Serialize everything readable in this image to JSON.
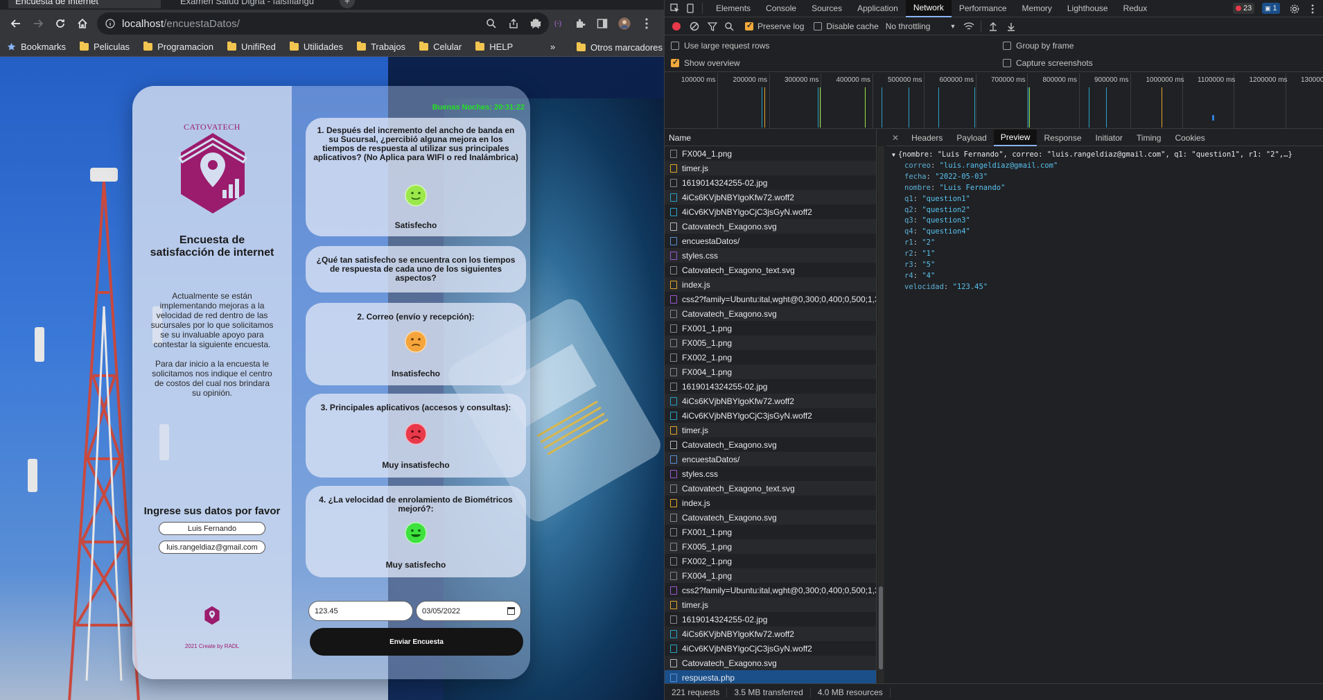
{
  "browser": {
    "tabs": [
      {
        "label": "Encuesta de Internet",
        "active": true
      },
      {
        "label": "Examen Salud Digna - falsIfiangu",
        "active": false
      }
    ],
    "url_host": "localhost",
    "url_path": "/encuestaDatos/",
    "bookmarks": [
      {
        "label": "Bookmarks",
        "icon": "star-icon"
      },
      {
        "label": "Peliculas",
        "icon": "folder-icon"
      },
      {
        "label": "Programacion",
        "icon": "folder-icon"
      },
      {
        "label": "UnifiRed",
        "icon": "folder-icon"
      },
      {
        "label": "Utilidades",
        "icon": "folder-icon"
      },
      {
        "label": "Trabajos",
        "icon": "folder-icon"
      },
      {
        "label": "Celular",
        "icon": "folder-icon"
      },
      {
        "label": "HELP",
        "icon": "folder-icon"
      }
    ],
    "bookmarks_more": "»",
    "other_bookmarks": "Otros marcadores"
  },
  "page": {
    "brand": "CATOVATECH",
    "title": "Encuesta de satisfacción de internet",
    "intro_p1": "Actualmente se están implementando mejoras a la velocidad de red dentro de las sucursales por lo que solicitamos se su invaluable apoyo para contestar la siguiente encuesta.",
    "intro_p2": "Para dar inicio a la encuesta le solicitamos nos indique el centro de costos del cual nos brindara su opinión.",
    "data_prompt": "Ingrese sus datos por favor",
    "name_value": "Luis Fernando",
    "email_value": "luis.rangeldiaz@gmail.com",
    "footer": "2021 Create by RADL",
    "greeting": "Buenas Noches: 20:31:22",
    "questions": [
      {
        "text": "1. Después del incremento del ancho de banda en su Sucursal, ¿percibió alguna mejora en los tiempos de respuesta al utilizar sus principales aplicativos? (No Aplica para WIFI o red Inalámbrica)",
        "answer": "Satisfecho",
        "face": "satisfied-face-icon",
        "color": "#9be84a"
      },
      {
        "text": "¿Qué tan satisfecho se encuentra con los tiempos de respuesta de cada uno de los siguientes aspectos?",
        "answer": "",
        "face": "",
        "color": ""
      },
      {
        "text": "2. Correo (envío y recepción):",
        "answer": "Insatisfecho",
        "face": "dissatisfied-face-icon",
        "color": "#f5a53b"
      },
      {
        "text": "3. Principales aplicativos (accesos y consultas):",
        "answer": "Muy insatisfecho",
        "face": "very-dissatisfied-face-icon",
        "color": "#e8394a"
      },
      {
        "text": "4. ¿La velocidad de enrolamiento de Biométricos mejoró?:",
        "answer": "Muy satisfecho",
        "face": "very-satisfied-face-icon",
        "color": "#3ee23e"
      }
    ],
    "speed_value": "123.45",
    "date_value": "03/05/2022",
    "submit_label": "Enviar Encuesta"
  },
  "devtools": {
    "tabs": [
      "Elements",
      "Console",
      "Sources",
      "Application",
      "Network",
      "Performance",
      "Memory",
      "Lighthouse",
      "Redux"
    ],
    "active_tab": "Network",
    "error_count": "23",
    "message_count": "1",
    "preserve_log": "Preserve log",
    "disable_cache": "Disable cache",
    "throttling": "No throttling",
    "options": {
      "large_rows": "Use large request rows",
      "show_overview": "Show overview",
      "group_by_frame": "Group by frame",
      "capture_screenshots": "Capture screenshots"
    },
    "timeline_ticks": [
      "100000 ms",
      "200000 ms",
      "300000 ms",
      "400000 ms",
      "500000 ms",
      "600000 ms",
      "700000 ms",
      "800000 ms",
      "900000 ms",
      "1000000 ms",
      "1100000 ms",
      "1200000 ms",
      "130000"
    ],
    "name_header": "Name",
    "requests": [
      {
        "name": "FX004_1.png",
        "type": "img"
      },
      {
        "name": "timer.js",
        "type": "js"
      },
      {
        "name": "1619014324255-02.jpg",
        "type": "img"
      },
      {
        "name": "4iCs6KVjbNBYlgoKfw72.woff2",
        "type": "font"
      },
      {
        "name": "4iCv6KVjbNBYlgoCjC3jsGyN.woff2",
        "type": "font"
      },
      {
        "name": "Catovatech_Exagono.svg",
        "type": "other"
      },
      {
        "name": "encuestaDatos/",
        "type": "doc"
      },
      {
        "name": "styles.css",
        "type": "css"
      },
      {
        "name": "Catovatech_Exagono_text.svg",
        "type": "img"
      },
      {
        "name": "index.js",
        "type": "js"
      },
      {
        "name": "css2?family=Ubuntu:ital,wght@0,300;0,400;0,500;1,3...",
        "type": "css"
      },
      {
        "name": "Catovatech_Exagono.svg",
        "type": "img"
      },
      {
        "name": "FX001_1.png",
        "type": "img"
      },
      {
        "name": "FX005_1.png",
        "type": "img"
      },
      {
        "name": "FX002_1.png",
        "type": "img"
      },
      {
        "name": "FX004_1.png",
        "type": "img"
      },
      {
        "name": "1619014324255-02.jpg",
        "type": "img"
      },
      {
        "name": "4iCs6KVjbNBYlgoKfw72.woff2",
        "type": "font"
      },
      {
        "name": "4iCv6KVjbNBYlgoCjC3jsGyN.woff2",
        "type": "font"
      },
      {
        "name": "timer.js",
        "type": "js"
      },
      {
        "name": "Catovatech_Exagono.svg",
        "type": "other"
      },
      {
        "name": "encuestaDatos/",
        "type": "doc"
      },
      {
        "name": "styles.css",
        "type": "css"
      },
      {
        "name": "Catovatech_Exagono_text.svg",
        "type": "img"
      },
      {
        "name": "index.js",
        "type": "js"
      },
      {
        "name": "Catovatech_Exagono.svg",
        "type": "img"
      },
      {
        "name": "FX001_1.png",
        "type": "img"
      },
      {
        "name": "FX005_1.png",
        "type": "img"
      },
      {
        "name": "FX002_1.png",
        "type": "img"
      },
      {
        "name": "FX004_1.png",
        "type": "img"
      },
      {
        "name": "css2?family=Ubuntu:ital,wght@0,300;0,400;0,500;1,3...",
        "type": "css"
      },
      {
        "name": "timer.js",
        "type": "js"
      },
      {
        "name": "1619014324255-02.jpg",
        "type": "img"
      },
      {
        "name": "4iCs6KVjbNBYlgoKfw72.woff2",
        "type": "font"
      },
      {
        "name": "4iCv6KVjbNBYlgoCjC3jsGyN.woff2",
        "type": "font"
      },
      {
        "name": "Catovatech_Exagono.svg",
        "type": "other"
      },
      {
        "name": "respuesta.php",
        "type": "doc",
        "selected": true
      }
    ],
    "detail_tabs": [
      "Headers",
      "Payload",
      "Preview",
      "Response",
      "Initiator",
      "Timing",
      "Cookies"
    ],
    "active_detail_tab": "Preview",
    "preview_summary": "{nombre: \"Luis Fernando\", correo: \"luis.rangeldiaz@gmail.com\", q1: \"question1\", r1: \"2\",…}",
    "preview_fields": [
      {
        "key": "correo",
        "value": "\"luis.rangeldiaz@gmail.com\""
      },
      {
        "key": "fecha",
        "value": "\"2022-05-03\""
      },
      {
        "key": "nombre",
        "value": "\"Luis Fernando\""
      },
      {
        "key": "q1",
        "value": "\"question1\""
      },
      {
        "key": "q2",
        "value": "\"question2\""
      },
      {
        "key": "q3",
        "value": "\"question3\""
      },
      {
        "key": "q4",
        "value": "\"question4\""
      },
      {
        "key": "r1",
        "value": "\"2\""
      },
      {
        "key": "r2",
        "value": "\"1\""
      },
      {
        "key": "r3",
        "value": "\"5\""
      },
      {
        "key": "r4",
        "value": "\"4\""
      },
      {
        "key": "velocidad",
        "value": "\"123.45\""
      }
    ],
    "status": {
      "requests": "221 requests",
      "transferred": "3.5 MB transferred",
      "resources": "4.0 MB resources"
    }
  },
  "colors": {
    "brand": "#9b1b6d",
    "greeting": "#25e025",
    "selected_row": "#1a4f8a",
    "devtools_bg": "#202124"
  }
}
